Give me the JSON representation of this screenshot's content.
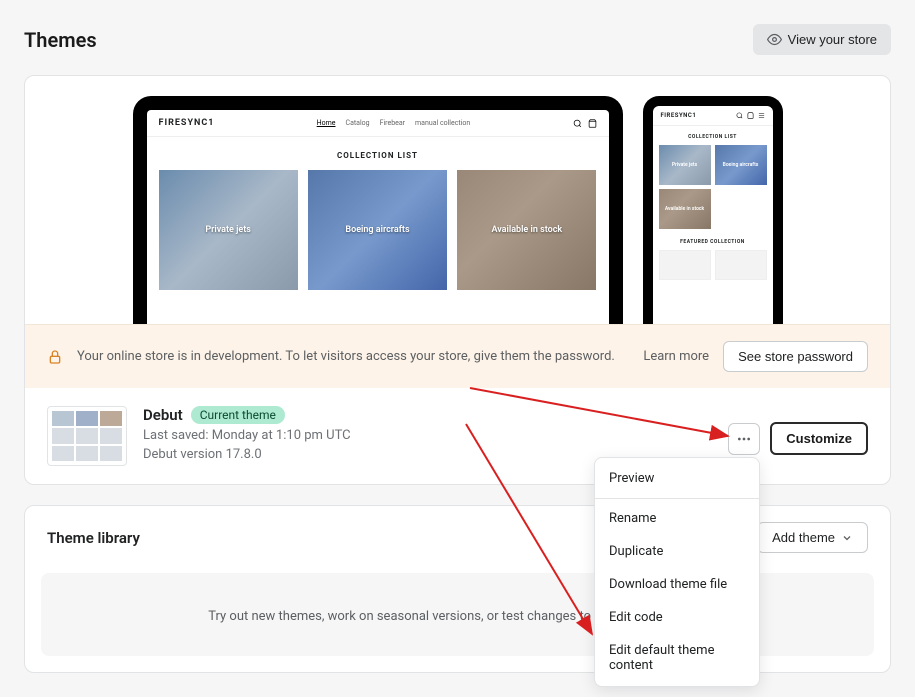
{
  "header": {
    "title": "Themes",
    "viewStoreLabel": "View your store"
  },
  "preview": {
    "brand": "FIRESYNC1",
    "nav": {
      "home": "Home",
      "catalog": "Catalog",
      "firebear": "Firebear",
      "manual": "manual collection"
    },
    "sectionTitle": "COLLECTION LIST",
    "tiles": {
      "privateJets": "Private jets",
      "boeing": "Boeing aircrafts",
      "available": "Available in stock"
    },
    "featuredTitle": "FEATURED COLLECTION"
  },
  "banner": {
    "message": "Your online store is in development. To let visitors access your store, give them the password.",
    "learnMore": "Learn more",
    "seePassword": "See store password"
  },
  "currentTheme": {
    "name": "Debut",
    "badge": "Current theme",
    "lastSaved": "Last saved: Monday at 1:10 pm UTC",
    "version": "Debut version 17.8.0",
    "customize": "Customize"
  },
  "library": {
    "title": "Theme library",
    "addTheme": "Add theme",
    "hint": "Try out new themes, work on seasonal versions, or test changes to your current theme."
  },
  "dropdown": {
    "preview": "Preview",
    "rename": "Rename",
    "duplicate": "Duplicate",
    "download": "Download theme file",
    "editCode": "Edit code",
    "editContent": "Edit default theme content"
  }
}
